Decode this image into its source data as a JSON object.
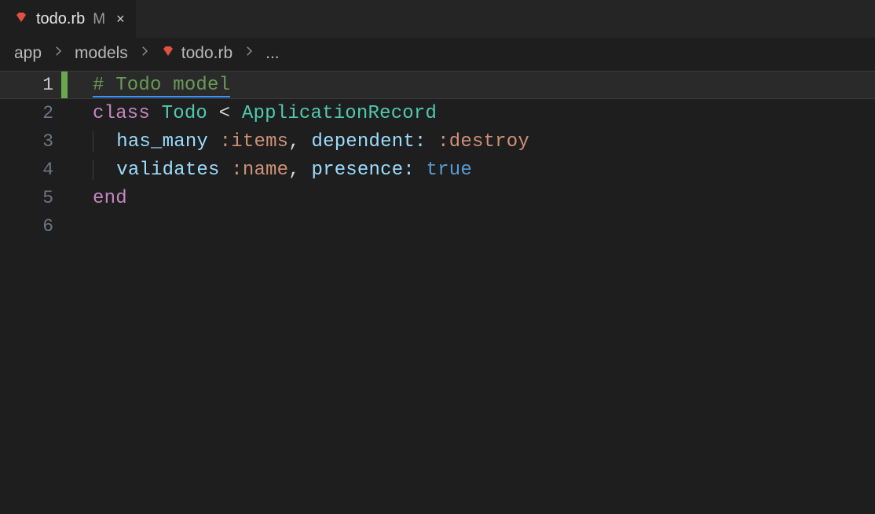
{
  "tab": {
    "filename": "todo.rb",
    "modified_indicator": "M",
    "close_glyph": "×"
  },
  "breadcrumbs": {
    "items": [
      "app",
      "models",
      "todo.rb"
    ],
    "trailing_ellipsis": "..."
  },
  "editor": {
    "lines": [
      {
        "num": "1",
        "active": true,
        "gutter_modified": true
      },
      {
        "num": "2",
        "active": false,
        "gutter_modified": false
      },
      {
        "num": "3",
        "active": false,
        "gutter_modified": false
      },
      {
        "num": "4",
        "active": false,
        "gutter_modified": false
      },
      {
        "num": "5",
        "active": false,
        "gutter_modified": false
      },
      {
        "num": "6",
        "active": false,
        "gutter_modified": false
      }
    ],
    "tokens": {
      "l1_comment": "# Todo model",
      "l2_class": "class",
      "l2_Todo": "Todo",
      "l2_lt": "<",
      "l2_AR": "ApplicationRecord",
      "l3_hasmany": "has_many",
      "l3_items": ":items",
      "l3_comma1": ",",
      "l3_dependent": "dependent:",
      "l3_destroy": ":destroy",
      "l4_validates": "validates",
      "l4_name": ":name",
      "l4_comma1": ",",
      "l4_presence": "presence:",
      "l4_true": "true",
      "l5_end": "end"
    }
  },
  "colors": {
    "bg": "#1e1e1e",
    "tabbar": "#252526",
    "ruby": "#e0523f"
  }
}
